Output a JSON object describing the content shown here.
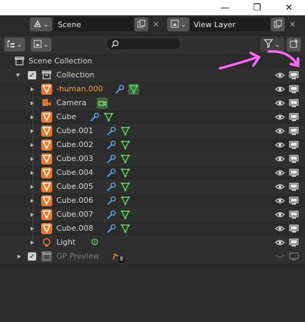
{
  "titlebar": {
    "minimize": "—",
    "maximize": "❐",
    "close": "✕"
  },
  "scene": {
    "value": "Scene"
  },
  "view_layer": {
    "value": "View Layer"
  },
  "tree": {
    "root": "Scene Collection",
    "collection": "Collection",
    "objects": [
      {
        "name": "-human.000",
        "type": "mesh",
        "highlight": true
      },
      {
        "name": "Camera",
        "type": "camera"
      },
      {
        "name": "Cube",
        "type": "mesh"
      },
      {
        "name": "Cube.001",
        "type": "mesh"
      },
      {
        "name": "Cube.002",
        "type": "mesh"
      },
      {
        "name": "Cube.003",
        "type": "mesh"
      },
      {
        "name": "Cube.004",
        "type": "mesh"
      },
      {
        "name": "Cube.005",
        "type": "mesh"
      },
      {
        "name": "Cube.006",
        "type": "mesh"
      },
      {
        "name": "Cube.007",
        "type": "mesh"
      },
      {
        "name": "Cube.008",
        "type": "mesh"
      },
      {
        "name": "Light",
        "type": "light"
      }
    ],
    "gp_collection": "GP Preview",
    "gp_count": "8"
  },
  "colors": {
    "annotation": "#ff66ff",
    "mesh": "#e9772b",
    "data": "#5fd15f",
    "modifier": "#5e9ad9",
    "highlight_text": "#f5a340"
  }
}
